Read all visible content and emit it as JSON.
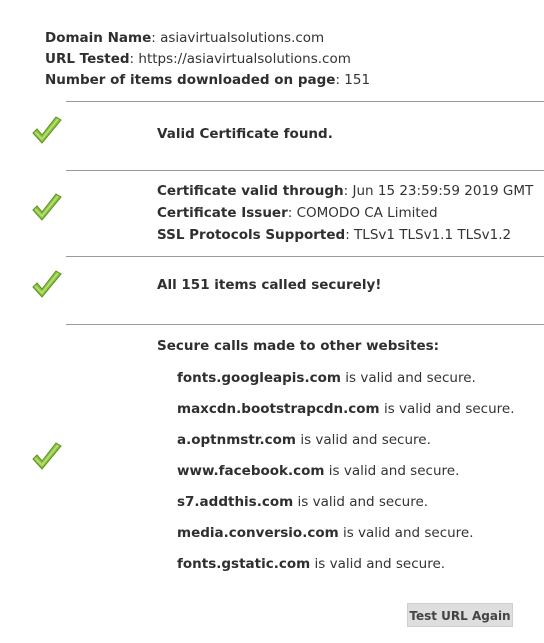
{
  "summary": {
    "domain_label": "Domain Name",
    "domain_value": "asiavirtualsolutions.com",
    "url_label": "URL Tested",
    "url_value": "https://asiavirtualsolutions.com",
    "items_label": "Number of items downloaded on page",
    "items_value": "151"
  },
  "sections": {
    "certificate_found": "Valid Certificate found.",
    "valid_through_label": "Certificate valid through",
    "valid_through_value": "Jun 15 23:59:59 2019 GMT",
    "issuer_label": "Certificate Issuer",
    "issuer_value": "COMODO CA Limited",
    "protocols_label": "SSL Protocols Supported",
    "protocols_value": "TLSv1 TLSv1.1 TLSv1.2",
    "secure_calls": "All 151 items called securely!"
  },
  "external_calls": {
    "heading": "Secure calls made to other websites:",
    "suffix": "is valid and secure.",
    "domains": [
      "fonts.googleapis.com",
      "maxcdn.bootstrapcdn.com",
      "a.optnmstr.com",
      "www.facebook.com",
      "s7.addthis.com",
      "media.conversio.com",
      "fonts.gstatic.com"
    ]
  },
  "actions": {
    "test_again_label": "Test URL Again"
  },
  "icons": {
    "status": "green-checkmark-icon"
  },
  "colors": {
    "check_green": "#8cc63f",
    "check_dark": "#5a8f1f",
    "divider": "#9a9a9a",
    "button_bg": "#dedede"
  }
}
